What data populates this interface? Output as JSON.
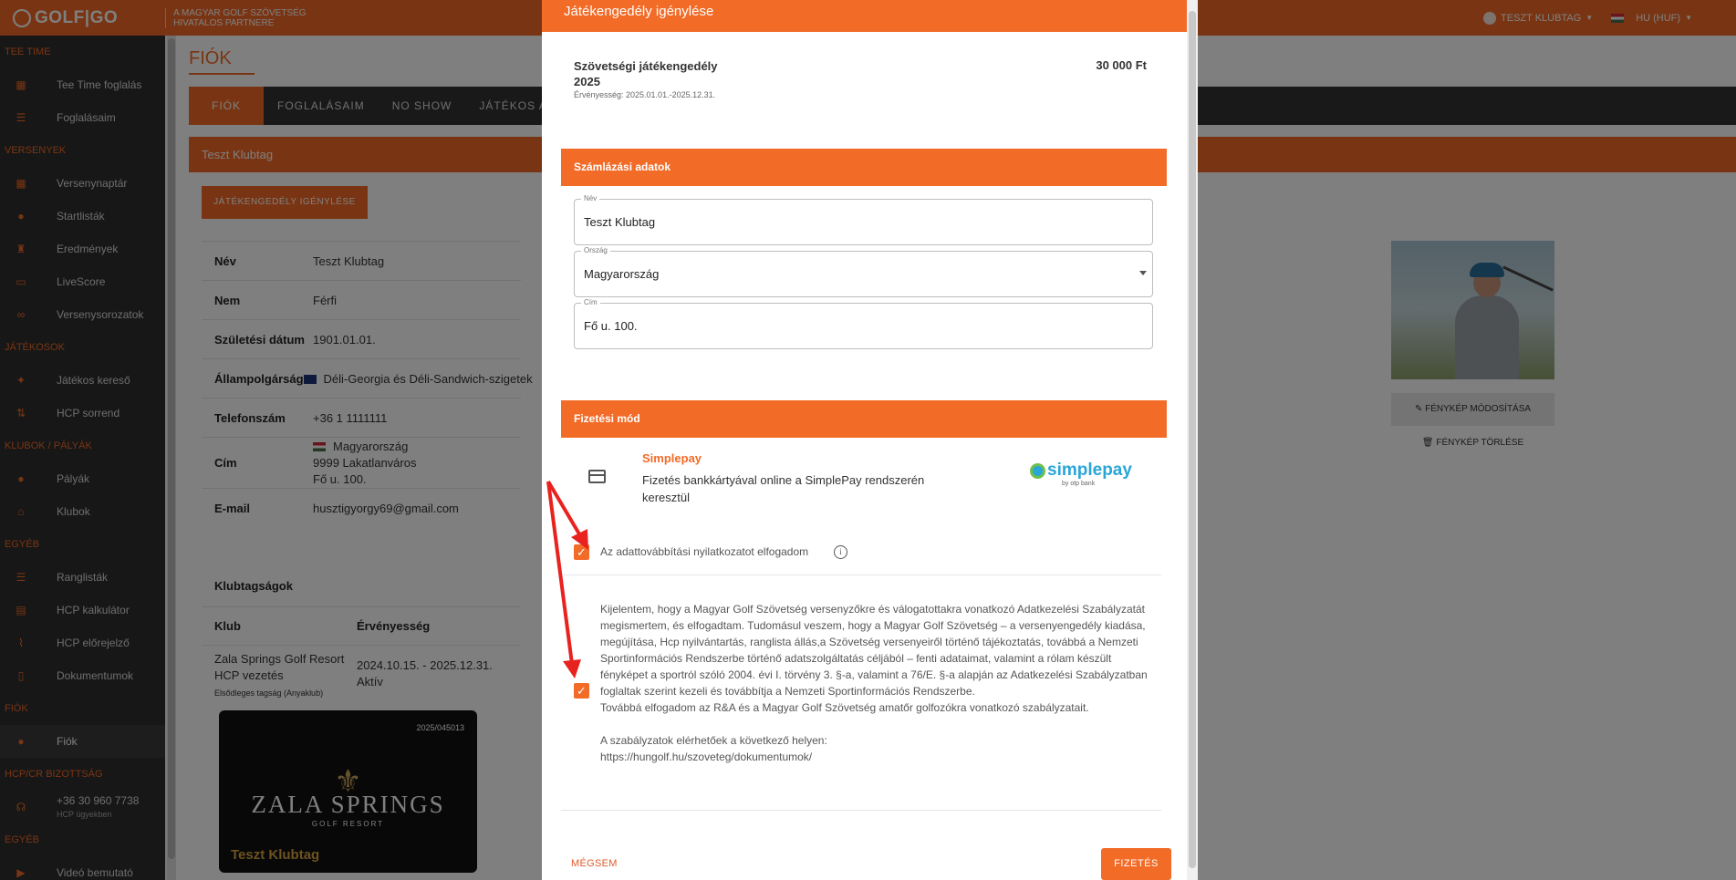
{
  "topbar": {
    "logo_text": "GOLF|GO",
    "partner_line1": "A MAGYAR GOLF SZÖVETSÉG",
    "partner_line2": "HIVATALOS PARTNERE",
    "user_name": "TESZT KLUBTAG",
    "language": "HU (HUF)"
  },
  "sidebar": {
    "sections": [
      {
        "title": "TEE TIME",
        "items": [
          {
            "label": "Tee Time foglalás",
            "icon": "calendar-icon"
          },
          {
            "label": "Foglalásaim",
            "icon": "list-icon"
          }
        ]
      },
      {
        "title": "VERSENYEK",
        "items": [
          {
            "label": "Versenynaptár",
            "icon": "calendar-icon"
          },
          {
            "label": "Startlisták",
            "icon": "pin-icon"
          },
          {
            "label": "Eredmények",
            "icon": "trophy-icon"
          },
          {
            "label": "LiveScore",
            "icon": "live-icon"
          },
          {
            "label": "Versenysorozatok",
            "icon": "link-icon"
          }
        ]
      },
      {
        "title": "JÁTÉKOSOK",
        "items": [
          {
            "label": "Játékos kereső",
            "icon": "runner-icon"
          },
          {
            "label": "HCP sorrend",
            "icon": "sort-icon"
          }
        ]
      },
      {
        "title": "KLUBOK / PÁLYÁK",
        "items": [
          {
            "label": "Pályák",
            "icon": "pin-icon"
          },
          {
            "label": "Klubok",
            "icon": "bank-icon"
          }
        ]
      },
      {
        "title": "EGYÉB",
        "items": [
          {
            "label": "Ranglisták",
            "icon": "list-icon"
          },
          {
            "label": "HCP kalkulátor",
            "icon": "calculator-icon"
          },
          {
            "label": "HCP előrejelző",
            "icon": "chart-icon"
          },
          {
            "label": "Dokumentumok",
            "icon": "document-icon"
          }
        ]
      },
      {
        "title": "FIÓK",
        "items": [
          {
            "label": "Fiók",
            "icon": "user-icon",
            "active": true
          }
        ]
      },
      {
        "title": "HCP/CR BIZOTTSÁG",
        "items": [
          {
            "label": "+36 30 960 7738",
            "sub": "HCP ügyekben",
            "icon": "headset-icon"
          }
        ]
      },
      {
        "title": "EGYÉB",
        "items": [
          {
            "label": "Videó bemutató",
            "icon": "video-icon"
          }
        ]
      }
    ]
  },
  "page": {
    "title": "FIÓK",
    "tabs": [
      "FIÓK",
      "FOGLALÁSAIM",
      "NO SHOW",
      "JÁTÉKOS ADA"
    ],
    "panel_title": "Teszt Klubtag",
    "permit_button": "JÁTÉKENGEDÉLY IGÉNYLÉSE",
    "info_rows": [
      {
        "key": "Név",
        "value": "Teszt Klubtag"
      },
      {
        "key": "Nem",
        "value": "Férfi"
      },
      {
        "key": "Születési dátum",
        "value": "1901.01.01."
      },
      {
        "key": "Állampolgárság",
        "value": "Déli-Georgia és Déli-Sandwich-szigetek"
      },
      {
        "key": "Telefonszám",
        "value": "+36 1 1111111"
      },
      {
        "key": "Cím",
        "value_lines": [
          "Magyarország",
          "9999 Lakatlanváros",
          "Fő u. 100."
        ]
      },
      {
        "key": "E-mail",
        "value": "husztigyorgy69@gmail.com"
      }
    ],
    "clubs_title": "Klubtagságok",
    "clubs_headers": [
      "Klub",
      "Érvényesség"
    ],
    "club_row": {
      "club": "Zala Springs Golf Resort HCP vezetés",
      "club_sub": "Elsődleges tagság (Anyaklub)",
      "validity": "2024.10.15. - 2025.12.31.",
      "status": "Aktív"
    },
    "card": {
      "number": "2025/045013",
      "name1": "ZALA SPRINGS",
      "name2": "GOLF RESORT",
      "member": "Teszt Klubtag"
    },
    "photo_edit": "FÉNYKÉP MÓDOSÍTÁSA",
    "photo_delete": "FÉNYKÉP TÖRLÉSE"
  },
  "modal": {
    "title": "Játékengedély igénylése",
    "license_line1": "Szövetségi játékengedély",
    "license_line2": "2025",
    "license_validity": "Érvényesség: 2025.01.01.-2025.12.31.",
    "license_price": "30 000 Ft",
    "billing_title": "Számlázási adatok",
    "fields": {
      "name_label": "Név",
      "name_value": "Teszt Klubtag",
      "country_label": "Ország",
      "country_value": "Magyarország",
      "address_label": "Cím",
      "address_value": "Fő u. 100."
    },
    "payment_title": "Fizetési mód",
    "payment_name": "Simplepay",
    "payment_desc": "Fizetés bankkártyával online a SimplePay rendszerén keresztül",
    "simplepay_logo": "simplepay",
    "simplepay_sub": "by otp bank",
    "checkbox1_label": "Az adattovábbítási nyilatkozatot elfogadom",
    "consent_p1": "Kijelentem, hogy a Magyar Golf Szövetség versenyzőkre és válogatottakra vonatkozó Adatkezelési Szabályzatát megismertem, és elfogadtam. Tudomásul veszem, hogy a Magyar Golf Szövetség – a versenyengedély kiadása, megújítása, Hcp nyilvántartás, ranglista állás,a Szövetség versenyeiről történő tájékoztatás, továbbá a Nemzeti Sportinformációs Rendszerbe történő adatszolgáltatás céljából – fenti adataimat, valamint a rólam készült fényképet a sportról szóló 2004. évi I. törvény 3. §-a, valamint a 76/E. §-a alapján az Adatkezelési Szabályzatban foglaltak szerint kezeli és továbbítja a Nemzeti Sportinformációs Rendszerbe.",
    "consent_p2": "Továbbá elfogadom az R&A és a Magyar Golf Szövetség amatőr golfozókra vonatkozó szabályzatait.",
    "consent_p3": "A szabályzatok elérhetőek a következő helyen:",
    "consent_link": "https://hungolf.hu/szoveteg/dokumentumok/",
    "cancel_button": "MÉGSEM",
    "pay_button": "FIZETÉS"
  },
  "colors": {
    "accent": "#f26b27",
    "sidebar": "#2e2e2e",
    "annotation_arrow": "#e8231f"
  }
}
